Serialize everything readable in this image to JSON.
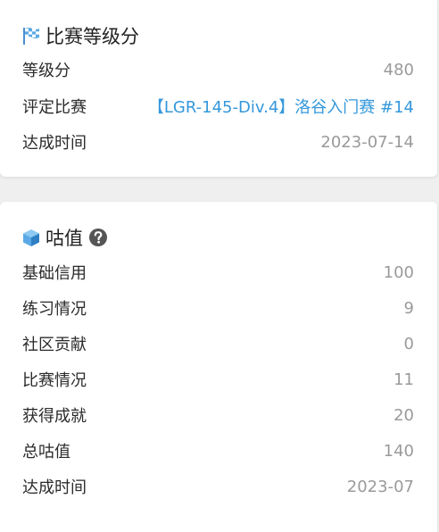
{
  "rating_card": {
    "title": "比赛等级分",
    "icon": "checkered-flag-icon",
    "rows": [
      {
        "label": "等级分",
        "value": "480"
      },
      {
        "label": "评定比赛",
        "value": "【LGR-145-Div.4】洛谷入门赛 #14"
      },
      {
        "label": "达成时间",
        "value": "2023-07-14"
      }
    ]
  },
  "gu_card": {
    "title": "咕值",
    "icon": "cube-icon",
    "help_icon": "question-circle-icon",
    "rows": [
      {
        "label": "基础信用",
        "value": "100"
      },
      {
        "label": "练习情况",
        "value": "9"
      },
      {
        "label": "社区贡献",
        "value": "0"
      },
      {
        "label": "比赛情况",
        "value": "11"
      },
      {
        "label": "获得成就",
        "value": "20"
      },
      {
        "label": "总咕值",
        "value": "140"
      },
      {
        "label": "达成时间",
        "value": "2023-07"
      }
    ]
  },
  "colors": {
    "link": "#3498db",
    "value_text": "#9a9a9a",
    "label_text": "#2b2b2b",
    "icon_blue": "#5aa9e6",
    "page_bg": "#efefef"
  }
}
